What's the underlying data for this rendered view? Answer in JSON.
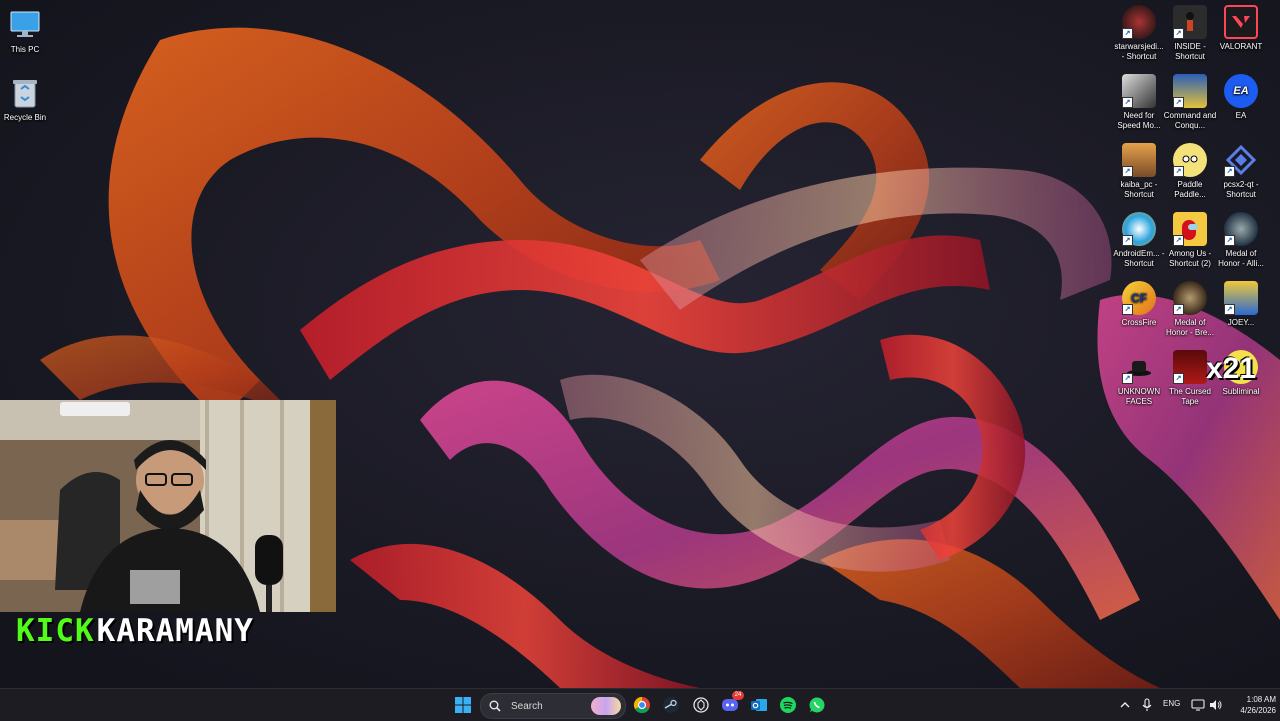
{
  "desktop": {
    "left_icons": [
      {
        "label": "This PC",
        "icon": "computer-monitor-icon"
      },
      {
        "label": "Recycle Bin",
        "icon": "recycle-bin-icon"
      }
    ],
    "right_icons": [
      {
        "label": "starwarsjedi... - Shortcut",
        "icon": "star-wars-jedi-icon"
      },
      {
        "label": "INSIDE - Shortcut",
        "icon": "inside-game-icon"
      },
      {
        "label": "VALORANT",
        "icon": "valorant-icon"
      },
      {
        "label": "Need for Speed Mo...",
        "icon": "need-for-speed-icon"
      },
      {
        "label": "Command and Conqu...",
        "icon": "command-and-conquer-icon"
      },
      {
        "label": "EA",
        "icon": "ea-icon"
      },
      {
        "label": "kaiba_pc - Shortcut",
        "icon": "kaiba-icon"
      },
      {
        "label": "Paddle Paddle...",
        "icon": "paddle-paddle-icon"
      },
      {
        "label": "pcsx2-qt - Shortcut",
        "icon": "pcsx2-icon"
      },
      {
        "label": "AndroidEm... - Shortcut",
        "icon": "android-emulator-icon"
      },
      {
        "label": "Among Us - Shortcut (2)",
        "icon": "among-us-icon"
      },
      {
        "label": "Medal of Honor - Alli...",
        "icon": "medal-of-honor-allied-icon"
      },
      {
        "label": "CrossFire",
        "icon": "crossfire-icon"
      },
      {
        "label": "Medal of Honor - Bre...",
        "icon": "medal-of-honor-breakthrough-icon"
      },
      {
        "label": "JOEY...",
        "icon": "joey-icon"
      },
      {
        "label": "UNKNOWN FACES",
        "icon": "unknown-faces-icon"
      },
      {
        "label": "The Cursed Tape",
        "icon": "cursed-tape-icon"
      },
      {
        "label": "Subliminal",
        "icon": "subliminal-icon"
      }
    ],
    "overlay_count": "x21"
  },
  "stream": {
    "platform_word": "KICK",
    "streamer_name": "KARAMANY"
  },
  "taskbar": {
    "search_placeholder": "Search",
    "apps": [
      "start-icon",
      "chrome-icon",
      "steam-icon",
      "chatgpt-icon",
      "discord-icon",
      "outlook-icon",
      "spotify-icon",
      "whatsapp-icon"
    ],
    "discord_badge": "24",
    "tray": {
      "language": "ENG",
      "time": "1:08 AM",
      "date": "4/26/2026"
    }
  },
  "colors": {
    "kick_green": "#53fc18",
    "taskbar_bg": "#1c1c22",
    "accent_blue": "#0078d4"
  }
}
